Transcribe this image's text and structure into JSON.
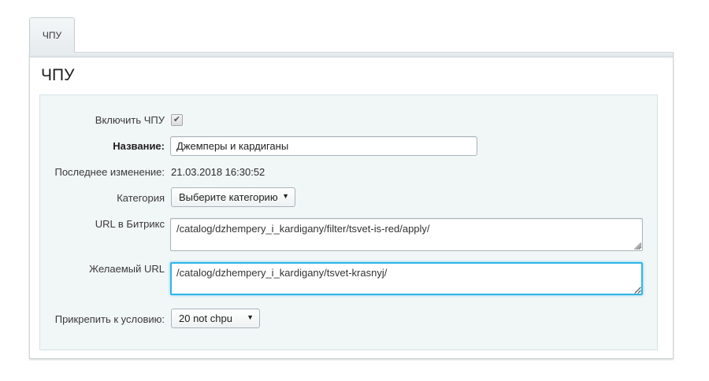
{
  "tab": {
    "label": "ЧПУ"
  },
  "panel": {
    "title": "ЧПУ"
  },
  "form": {
    "enable_label": "Включить ЧПУ",
    "enable_checked": true,
    "name_label": "Название:",
    "name_value": "Джемперы и кардиганы",
    "last_modified_label": "Последнее изменение:",
    "last_modified_value": "21.03.2018 16:30:52",
    "category_label": "Категория",
    "category_selected": "Выберите категорию",
    "bitrix_url_label": "URL в Битрикс",
    "bitrix_url_value": "/catalog/dzhempery_i_kardigany/filter/tsvet-is-red/apply/",
    "desired_url_label": "Желаемый URL",
    "desired_url_value": "/catalog/dzhempery_i_kardigany/tsvet-krasnyj/",
    "condition_label": "Прикрепить к условию:",
    "condition_selected": "20 not chpu"
  },
  "icons": {
    "checkbox_check": "checkmark-icon",
    "select_arrow": "caret-down-icon"
  },
  "colors": {
    "focus_border": "#2eb6e8",
    "form_background": "#f1f6f7"
  }
}
